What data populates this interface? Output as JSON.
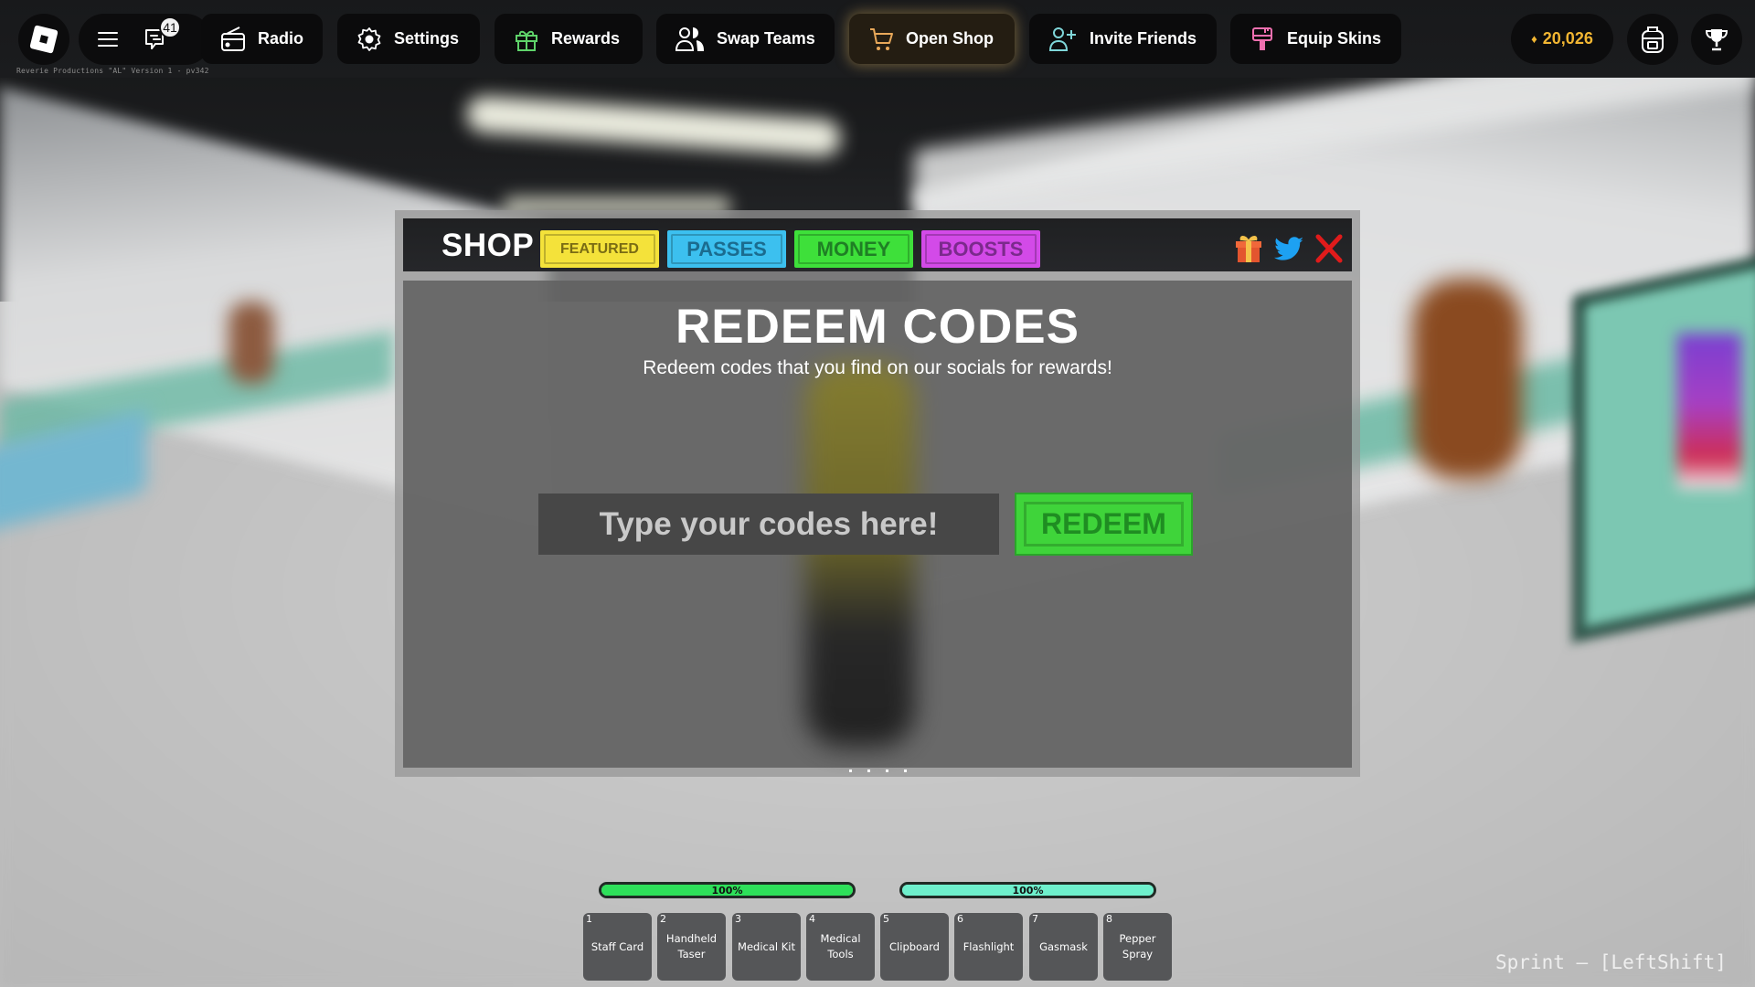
{
  "topbar": {
    "notification_count": "41",
    "version_text": "Reverie Productions \"AL\" Version 1 - pv342",
    "buttons": [
      {
        "label": "Radio",
        "icon": "radio-icon"
      },
      {
        "label": "Settings",
        "icon": "gear-icon"
      },
      {
        "label": "Rewards",
        "icon": "gift-icon"
      },
      {
        "label": "Swap Teams",
        "icon": "users-icon"
      },
      {
        "label": "Open Shop",
        "icon": "cart-icon",
        "active": true
      },
      {
        "label": "Invite Friends",
        "icon": "user-plus-icon"
      },
      {
        "label": "Equip Skins",
        "icon": "paintbrush-icon"
      }
    ],
    "currency": {
      "symbol": "♦",
      "amount": "20,026"
    },
    "colors": {
      "rewards_icon": "#5fd36a",
      "shop_icon": "#e8a85a",
      "invite_icon": "#7fd6d9",
      "skins_icon": "#f070b0",
      "currency": "#f2b632"
    }
  },
  "shop": {
    "title": "SHOP",
    "tabs": [
      {
        "label": "FEATURED",
        "color": "#f4e23a"
      },
      {
        "label": "PASSES",
        "color": "#3cc0ef"
      },
      {
        "label": "MONEY",
        "color": "#3ee03a"
      },
      {
        "label": "BOOSTS",
        "color": "#d34ae8"
      }
    ],
    "header_icons": [
      "gift-icon",
      "twitter-icon",
      "close-icon"
    ],
    "heading": "REDEEM CODES",
    "subheading": "Redeem codes that you find on our socials for rewards!",
    "input": {
      "value": "",
      "placeholder": "Type your codes here!"
    },
    "redeem_label": "REDEEM"
  },
  "hud": {
    "bars": [
      {
        "name": "health",
        "label": "100%",
        "value": 1.0,
        "color": "#2ee05a"
      },
      {
        "name": "stamina",
        "label": "100%",
        "value": 1.0,
        "color": "#6ef0cc"
      }
    ],
    "hotbar": [
      {
        "key": "1",
        "label": "Staff Card"
      },
      {
        "key": "2",
        "label": "Handheld Taser"
      },
      {
        "key": "3",
        "label": "Medical Kit"
      },
      {
        "key": "4",
        "label": "Medical Tools"
      },
      {
        "key": "5",
        "label": "Clipboard"
      },
      {
        "key": "6",
        "label": "Flashlight"
      },
      {
        "key": "7",
        "label": "Gasmask"
      },
      {
        "key": "8",
        "label": "Pepper Spray"
      }
    ],
    "sprint_hint": "Sprint — [LeftShift]"
  }
}
